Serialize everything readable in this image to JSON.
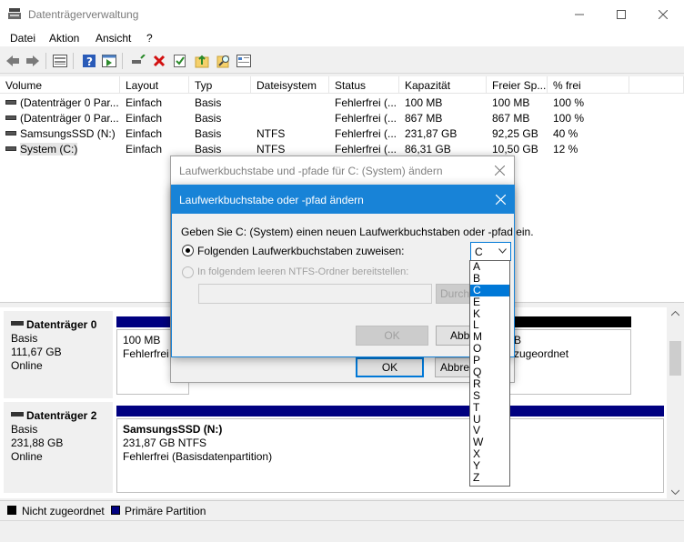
{
  "window": {
    "title": "Datenträgerverwaltung"
  },
  "menu": [
    "Datei",
    "Aktion",
    "Ansicht",
    "?"
  ],
  "columns": [
    "Volume",
    "Layout",
    "Typ",
    "Dateisystem",
    "Status",
    "Kapazität",
    "Freier Sp...",
    "% frei"
  ],
  "volumes": [
    {
      "volume": "(Datenträger 0 Par...",
      "layout": "Einfach",
      "typ": "Basis",
      "fs": "",
      "status": "Fehlerfrei (...",
      "cap": "100 MB",
      "free": "100 MB",
      "pct": "100 %"
    },
    {
      "volume": "(Datenträger 0 Par...",
      "layout": "Einfach",
      "typ": "Basis",
      "fs": "",
      "status": "Fehlerfrei (...",
      "cap": "867 MB",
      "free": "867 MB",
      "pct": "100 %"
    },
    {
      "volume": "SamsungsSSD (N:)",
      "layout": "Einfach",
      "typ": "Basis",
      "fs": "NTFS",
      "status": "Fehlerfrei (...",
      "cap": "231,87 GB",
      "free": "92,25 GB",
      "pct": "40 %"
    },
    {
      "volume": "System (C:)",
      "layout": "Einfach",
      "typ": "Basis",
      "fs": "NTFS",
      "status": "Fehlerfrei (...",
      "cap": "86,31 GB",
      "free": "10,50 GB",
      "pct": "12 %"
    }
  ],
  "disks": [
    {
      "name": "Datenträger 0",
      "type": "Basis",
      "size": "111,67 GB",
      "state": "Online",
      "part1_size": "100 MB",
      "part1_status": "Fehlerfrei",
      "part_right_tail": "B",
      "part_right_status": "zugeordnet"
    },
    {
      "name": "Datenträger 2",
      "type": "Basis",
      "size": "231,88 GB",
      "state": "Online",
      "part_name": "SamsungsSSD  (N:)",
      "part_size": "231,87 GB NTFS",
      "part_status": "Fehlerfrei (Basisdatenpartition)"
    }
  ],
  "legend": [
    {
      "label": "Nicht zugeordnet",
      "color": "#000000"
    },
    {
      "label": "Primäre Partition",
      "color": "#000080"
    }
  ],
  "back_dialog": {
    "title": "Laufwerkbuchstabe und -pfade für C: (System) ändern",
    "ok": "OK",
    "cancel": "Abbrec"
  },
  "front_dialog": {
    "title": "Laufwerkbuchstabe oder -pfad ändern",
    "prompt": "Geben Sie C: (System) einen neuen Laufwerkbuchstaben oder -pfad ein.",
    "option_letter": "Folgenden Laufwerkbuchstaben zuweisen:",
    "option_folder": "In folgendem leeren NTFS-Ordner bereitstellen:",
    "browse": "Durchs",
    "ok": "OK",
    "cancel": "Abbre",
    "selected_letter": "C"
  },
  "letters": [
    "A",
    "B",
    "C",
    "E",
    "K",
    "L",
    "M",
    "O",
    "P",
    "Q",
    "R",
    "S",
    "T",
    "U",
    "V",
    "W",
    "X",
    "Y",
    "Z"
  ],
  "selected_letter_index": 2,
  "colors": {
    "accent": "#0078d7",
    "dialog_header": "#1883d7",
    "primary_partition": "#000080"
  }
}
